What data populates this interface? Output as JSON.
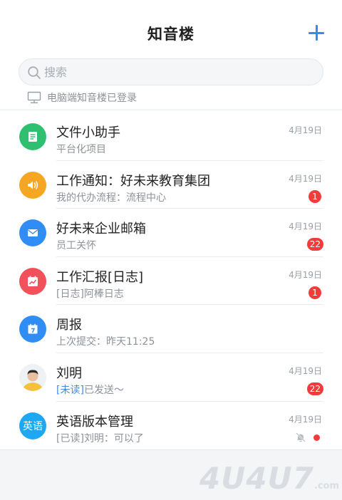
{
  "header": {
    "title": "知音楼",
    "add_label": ""
  },
  "search": {
    "placeholder": "搜索"
  },
  "pc_login": {
    "text": "电脑端知音楼已登录"
  },
  "conversations": [
    {
      "name": "文件小助手",
      "subtitle": "平台化项目",
      "date": "4月19日",
      "badge": "",
      "icon": "file-helper-icon",
      "color": "#2fbf71"
    },
    {
      "name": "工作通知：好未来教育集团",
      "subtitle": "我的代办流程：流程中心",
      "date": "4月19日",
      "badge": "1",
      "icon": "speaker-icon",
      "color": "#f5a623"
    },
    {
      "name": "好未来企业邮箱",
      "subtitle": "员工关怀",
      "date": "4月19日",
      "badge": "22",
      "icon": "mail-icon",
      "color": "#2f8df5"
    },
    {
      "name": "工作汇报[日志]",
      "subtitle": "[日志]阿棒日志",
      "date": "4月19日",
      "badge": "1",
      "icon": "report-chart-icon",
      "color": "#f0515a"
    },
    {
      "name": "周报",
      "subtitle": "上次提交：昨天11:25",
      "date": "",
      "badge": "",
      "icon": "calendar-icon",
      "color": "#2f8df5"
    },
    {
      "name": "刘明",
      "subtitle_tag": "[未读]",
      "subtitle_rest": "已发送～",
      "date": "4月19日",
      "badge": "22",
      "icon": "user-avatar",
      "color": "#f3c13a"
    },
    {
      "name": "英语版本管理",
      "subtitle_tag": "[已读]",
      "subtitle_rest": "刘明：可以了",
      "date": "4月19日",
      "badge": "",
      "avatar_text": "英语",
      "icon": "group-avatar",
      "color": "#1ea7f2"
    }
  ],
  "watermark": {
    "main": "4U4U7",
    "suffix": ".com"
  }
}
